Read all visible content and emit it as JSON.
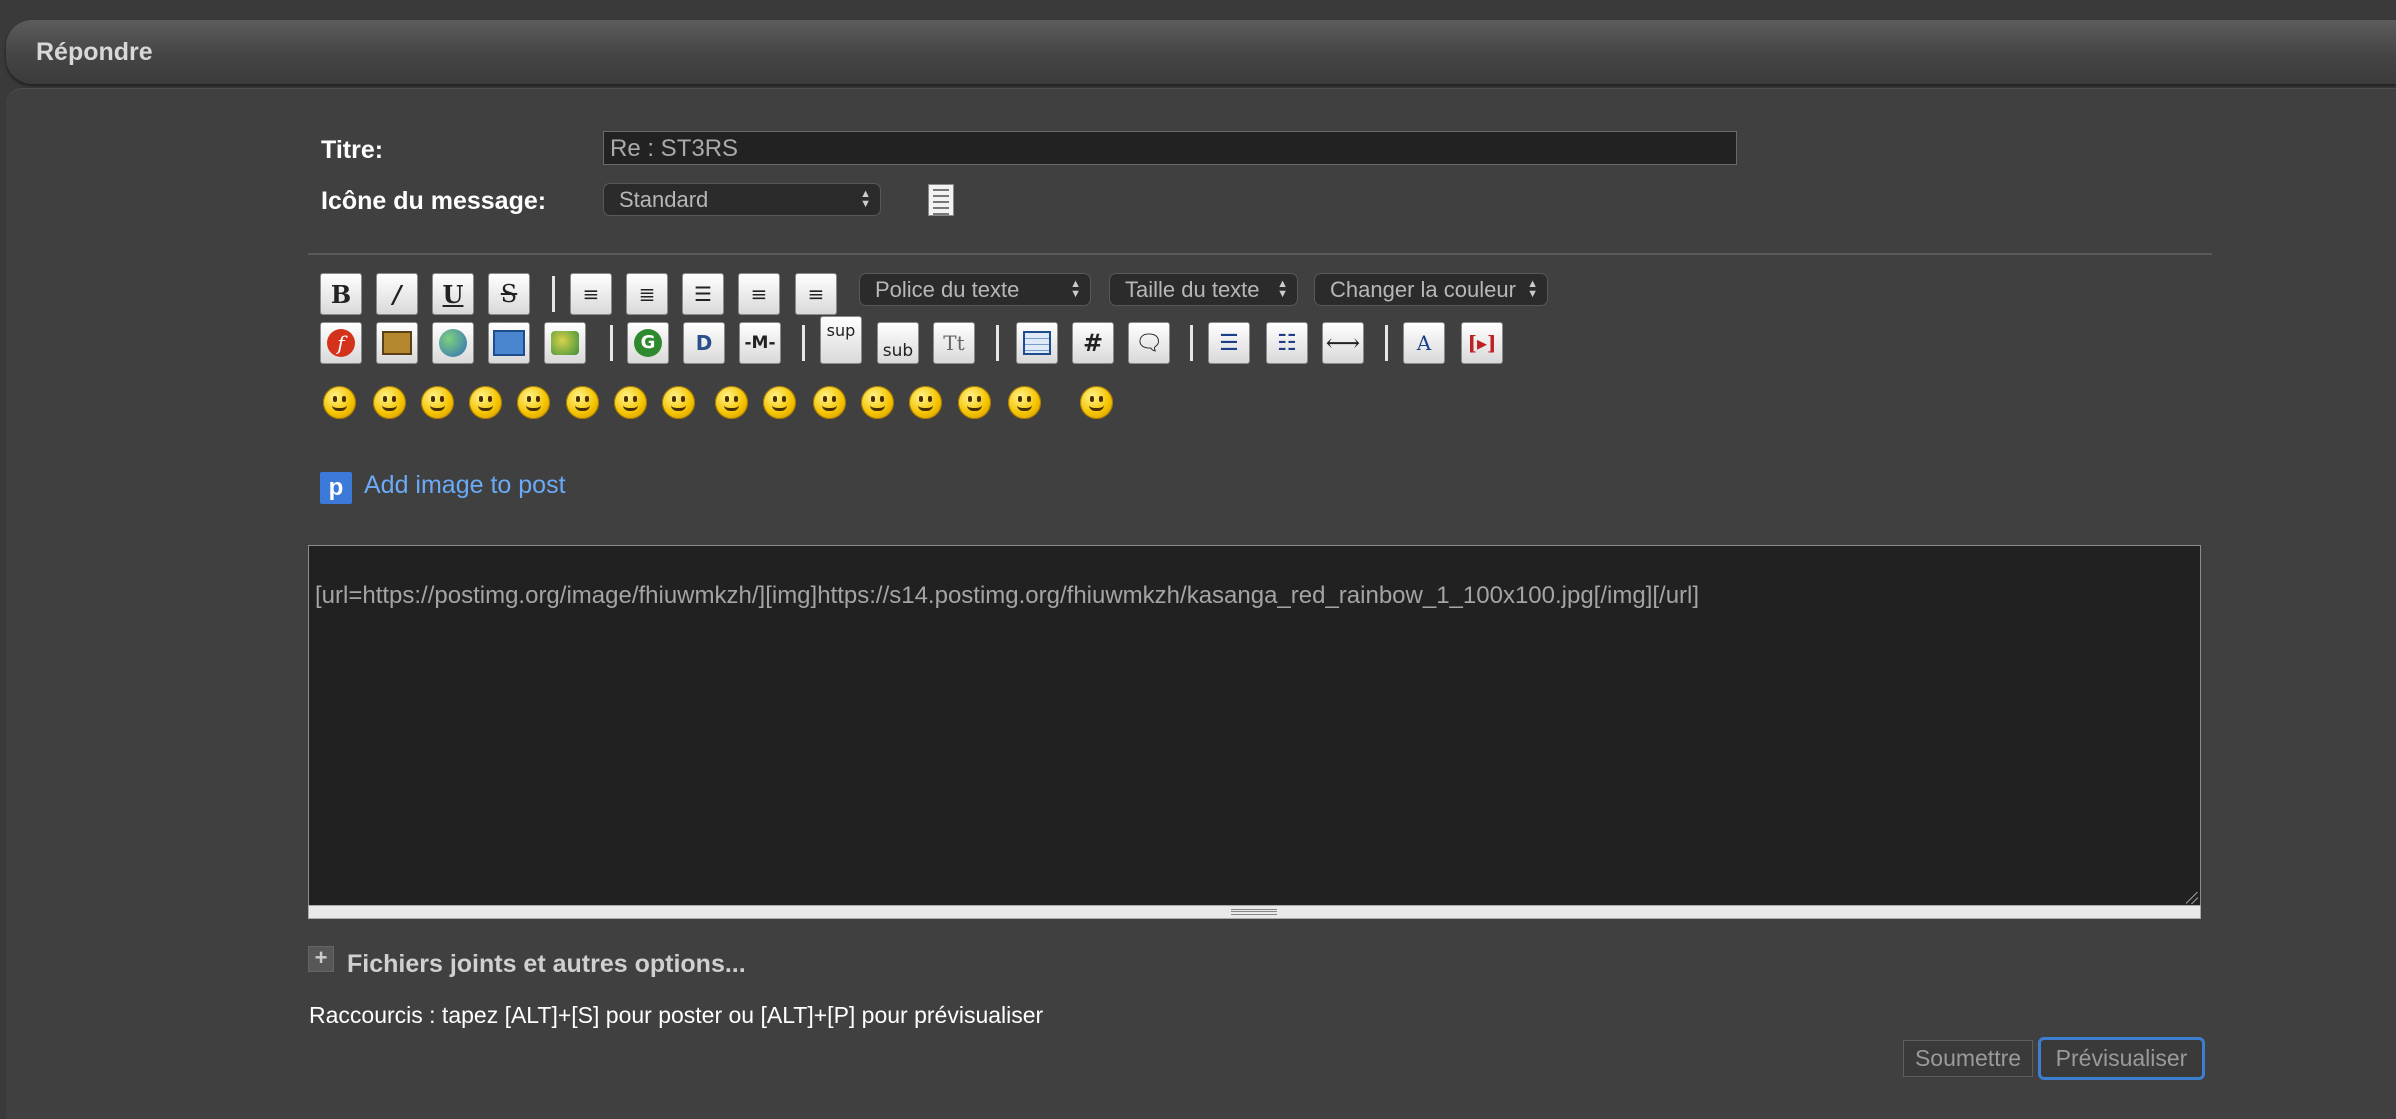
{
  "header": {
    "title": "Répondre"
  },
  "form": {
    "title_label": "Titre:",
    "title_value": "Re : ST3RS",
    "icon_label": "Icône du message:",
    "icon_select": "Standard"
  },
  "toolbar": {
    "font_select": "Police du texte",
    "size_select": "Taille du texte",
    "color_select": "Changer la couleur",
    "row1_buttons": [
      {
        "icon": "bold-icon",
        "text": "B"
      },
      {
        "icon": "italic-icon",
        "text": "I"
      },
      {
        "icon": "underline-icon",
        "text": "U"
      },
      {
        "icon": "strike-icon",
        "text": "S"
      },
      {
        "icon": "align-left-icon"
      },
      {
        "icon": "align-justify-icon"
      },
      {
        "icon": "align-left-2-icon"
      },
      {
        "icon": "align-center-icon"
      },
      {
        "icon": "align-right-icon"
      }
    ],
    "row2_buttons": [
      {
        "icon": "flash-icon"
      },
      {
        "icon": "image-icon"
      },
      {
        "icon": "link-globe-icon"
      },
      {
        "icon": "email-icon"
      },
      {
        "icon": "host-image-icon"
      },
      {
        "icon": "google-icon",
        "text": "G"
      },
      {
        "icon": "dailymotion-icon",
        "text": "D"
      },
      {
        "icon": "hr-icon",
        "text": "-M-"
      },
      {
        "icon": "superscript-icon",
        "text": "sup"
      },
      {
        "icon": "subscript-icon",
        "text": "sub"
      },
      {
        "icon": "teletype-icon",
        "text": "Tt"
      },
      {
        "icon": "table-icon"
      },
      {
        "icon": "hash-icon",
        "text": "#"
      },
      {
        "icon": "quote-icon"
      },
      {
        "icon": "bullet-list-icon"
      },
      {
        "icon": "numbered-list-icon"
      },
      {
        "icon": "horizontal-rule-icon"
      },
      {
        "icon": "font-icon"
      },
      {
        "icon": "select-icon"
      }
    ],
    "smiley_count": 16
  },
  "add_image": {
    "label": "Add image to post"
  },
  "editor": {
    "content": "[url=https://postimg.org/image/fhiuwmkzh/][img]https://s14.postimg.org/fhiuwmkzh/kasanga_red_rainbow_1_100x100.jpg[/img][/url]"
  },
  "options": {
    "attachments_label": "Fichiers joints et autres options...",
    "shortcuts_text": "Raccourcis : tapez [ALT]+[S] pour poster ou [ALT]+[P] pour prévisualiser"
  },
  "buttons": {
    "submit": "Soumettre",
    "preview": "Prévisualiser"
  },
  "colors": {
    "background": "#3a3a3a",
    "link": "#6aaaf7",
    "focus": "#3c7fd0"
  }
}
